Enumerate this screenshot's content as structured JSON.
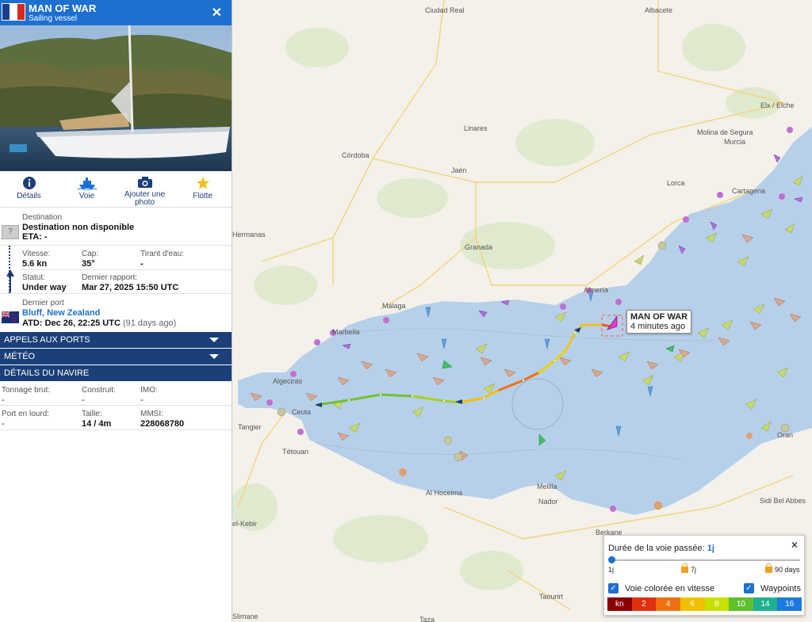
{
  "vessel": {
    "name": "MAN OF WAR",
    "type": "Sailing vessel",
    "flag_colors": [
      "#1a3e8f",
      "#ffffff",
      "#d52b1e"
    ]
  },
  "actions": [
    {
      "label": "Détails",
      "icon": "info-icon"
    },
    {
      "label": "Voie",
      "icon": "ship-track-icon"
    },
    {
      "label": "Ajouter une photo",
      "icon": "camera-icon"
    },
    {
      "label": "Flotte",
      "icon": "star-icon"
    }
  ],
  "destination": {
    "label": "Destination",
    "value": "Destination non disponible",
    "eta": "ETA: -",
    "icon_text": "?"
  },
  "speed": {
    "label": "Vitesse:",
    "value": "5.6 kn"
  },
  "course": {
    "label": "Cap:",
    "value": "35°"
  },
  "draught": {
    "label": "Tirant d'eau:",
    "value": "-"
  },
  "status": {
    "label": "Statut:",
    "value": "Under way"
  },
  "last_report": {
    "label": "Dernier rapport:",
    "value": "Mar 27, 2025 15:50 UTC"
  },
  "last_port": {
    "label": "Dernier port",
    "value": "Bluff, New Zealand",
    "atd": "ATD: Dec 26, 22:25 UTC",
    "ago": "(91 days ago)"
  },
  "sections": [
    "APPELS AUX PORTS",
    "MÉTÉO",
    "DÉTAILS DU NAVIRE"
  ],
  "details": {
    "gross_tonnage": {
      "label": "Tonnage brut:",
      "value": "-"
    },
    "built": {
      "label": "Construit:",
      "value": "-"
    },
    "imo": {
      "label": "IMO:",
      "value": "-"
    },
    "deadweight": {
      "label": "Port en lourd:",
      "value": "-"
    },
    "size": {
      "label": "Taille:",
      "value": "14 / 4m"
    },
    "mmsi": {
      "label": "MMSI:",
      "value": "228068780"
    }
  },
  "map": {
    "cities": [
      "Ciudad Real",
      "Albacete",
      "Linares",
      "Córdoba",
      "Jaén",
      "Elx / Elche",
      "Molina de Segura",
      "Murcia",
      "Lorca",
      "Cartagena",
      "Hermanas",
      "Granada",
      "Almería",
      "Málaga",
      "Marbella",
      "Algeciras",
      "Ceuta",
      "Tangier",
      "Tétouan",
      "Al Hoceima",
      "Melilla",
      "Nador",
      "Oran",
      "Sidi Bel Abbes",
      "Berkane",
      "Taourirt",
      "Taza",
      "Slimane",
      "el-Kebir"
    ],
    "tooltip": {
      "name": "MAN OF WAR",
      "ago": "4 minutes ago"
    }
  },
  "track_control": {
    "title": "Durée de la voie passée:",
    "value": "1j",
    "ticks": [
      "1j",
      "7j",
      "90 days"
    ],
    "checkbox_speed": "Voie colorée en vitesse",
    "checkbox_waypoints": "Waypoints",
    "speed_scale": [
      "kn",
      "2",
      "4",
      "6",
      "8",
      "10",
      "14",
      "16"
    ],
    "speed_colors": [
      "#8b0000",
      "#e03010",
      "#f07010",
      "#f0c000",
      "#c8e000",
      "#60c030",
      "#20b090",
      "#1c7ae0"
    ]
  }
}
